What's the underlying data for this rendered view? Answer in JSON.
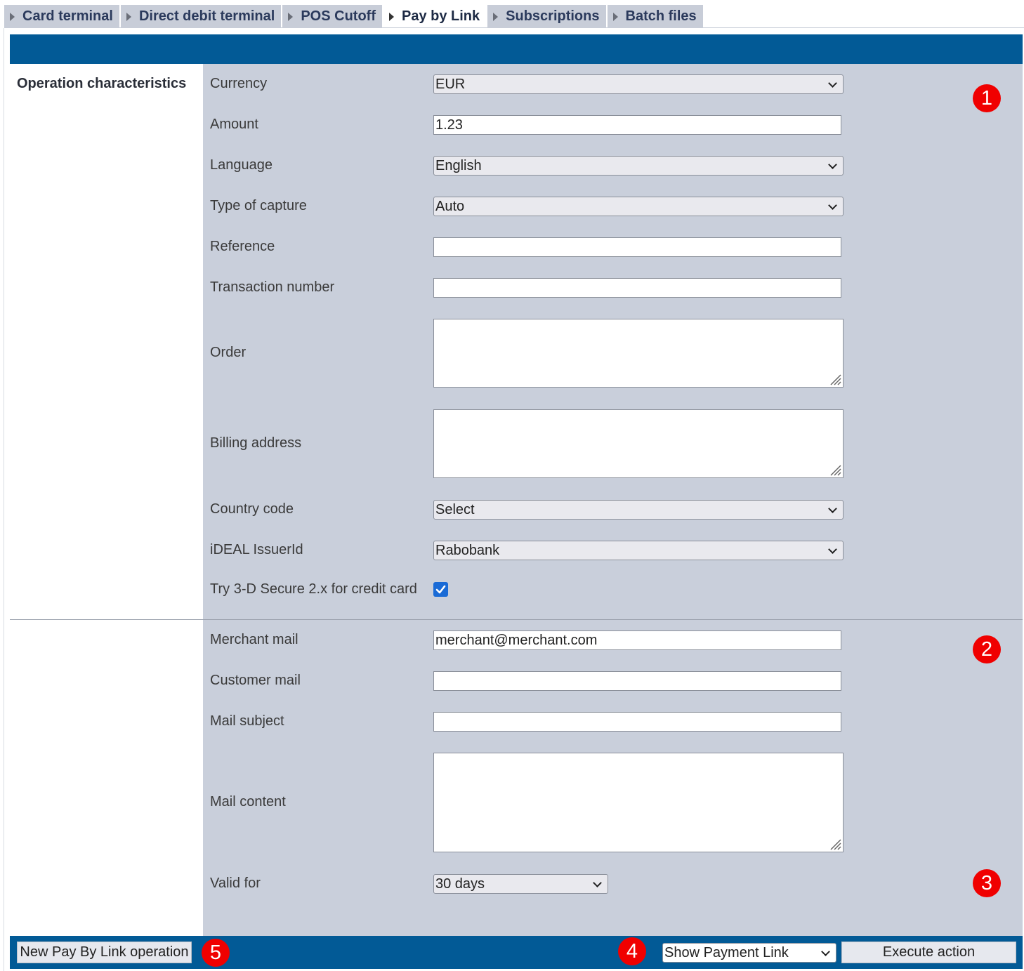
{
  "tabs": [
    {
      "label": "Card terminal"
    },
    {
      "label": "Direct debit terminal"
    },
    {
      "label": "POS Cutoff"
    },
    {
      "label": "Pay by Link"
    },
    {
      "label": "Subscriptions"
    },
    {
      "label": "Batch files"
    }
  ],
  "active_tab": "Pay by Link",
  "section": {
    "title": "Operation characteristics"
  },
  "form": {
    "currency": {
      "label": "Currency",
      "value": "EUR"
    },
    "amount": {
      "label": "Amount",
      "value": "1.23"
    },
    "language": {
      "label": "Language",
      "value": "English"
    },
    "capture": {
      "label": "Type of capture",
      "value": "Auto"
    },
    "reference": {
      "label": "Reference",
      "value": ""
    },
    "transaction": {
      "label": "Transaction number",
      "value": ""
    },
    "order": {
      "label": "Order",
      "value": ""
    },
    "billing": {
      "label": "Billing address",
      "value": ""
    },
    "country": {
      "label": "Country code",
      "value": "Select"
    },
    "ideal": {
      "label": "iDEAL IssuerId",
      "value": "Rabobank"
    },
    "secure": {
      "label": "Try 3-D Secure 2.x for credit card",
      "checked": true
    },
    "merchant_mail": {
      "label": "Merchant mail",
      "value": "merchant@merchant.com"
    },
    "customer_mail": {
      "label": "Customer mail",
      "value": ""
    },
    "mail_subject": {
      "label": "Mail subject",
      "value": ""
    },
    "mail_content": {
      "label": "Mail content",
      "value": ""
    },
    "valid_for": {
      "label": "Valid for",
      "value": "30 days"
    }
  },
  "footer": {
    "new_button": "New Pay By Link operation",
    "action_select": "Show Payment Link",
    "execute_button": "Execute action"
  },
  "badges": [
    "1",
    "2",
    "3",
    "4",
    "5"
  ],
  "colors": {
    "header_blue": "#025a96",
    "form_bg": "#c9cfdb",
    "badge_red": "#f00000",
    "checkbox_blue": "#1a6bd6"
  }
}
